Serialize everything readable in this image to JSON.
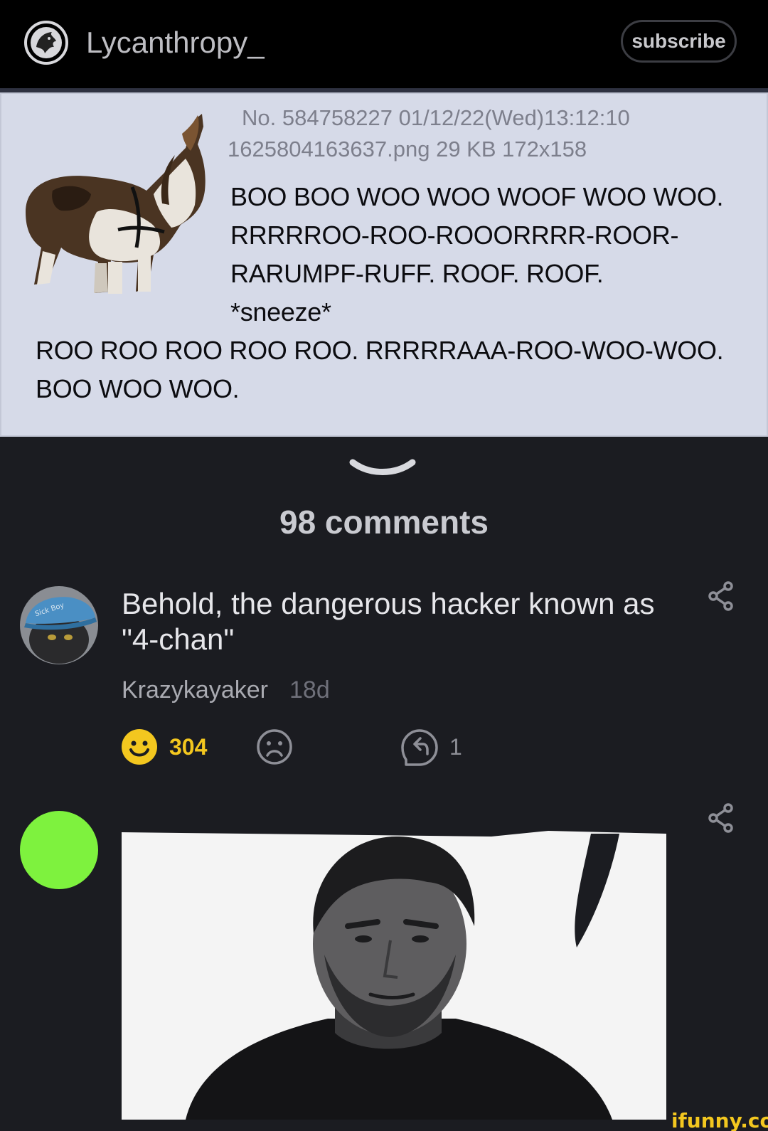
{
  "header": {
    "channel_name": "Lycanthropy_",
    "subscribe_label": "subscribe",
    "logo_icon": "wolf-emblem-icon"
  },
  "post": {
    "meta_line1": "No. 584758227 01/12/22(Wed)13:12:10",
    "meta_line2": "1625804163637.png 29 KB 172x158",
    "body_line1": "BOO BOO WOO WOO WOOF WOO WOO.",
    "body_line2": "RRRRROO-ROO-ROOORRRR-ROOR-",
    "body_line3": "RARUMPF-RUFF. ROOF. ROOF.",
    "body_line4": "*sneeze*",
    "body_line5": "ROO ROO ROO ROO ROO. RRRRRAAA-ROO-WOO-WOO.",
    "body_line6": "BOO WOO WOO.",
    "image_icon": "howling-basset-hound-image"
  },
  "comments": {
    "count_label": "98 comments",
    "items": [
      {
        "text": "Behold, the dangerous hacker known as \"4-chan\"",
        "user": "Krazykayaker",
        "time": "18d",
        "likes": "304",
        "replies": "1",
        "avatar_icon": "cat-in-cap-avatar"
      },
      {
        "avatar_color": "#7ef23e",
        "image_icon": "man-portrait-image"
      }
    ]
  },
  "watermark": "ifunny.co",
  "colors": {
    "background": "#1b1c21",
    "header": "#000000",
    "post_bg": "#d6dae8",
    "accent_yellow": "#f3c71f",
    "avatar_green": "#7ef23e"
  }
}
